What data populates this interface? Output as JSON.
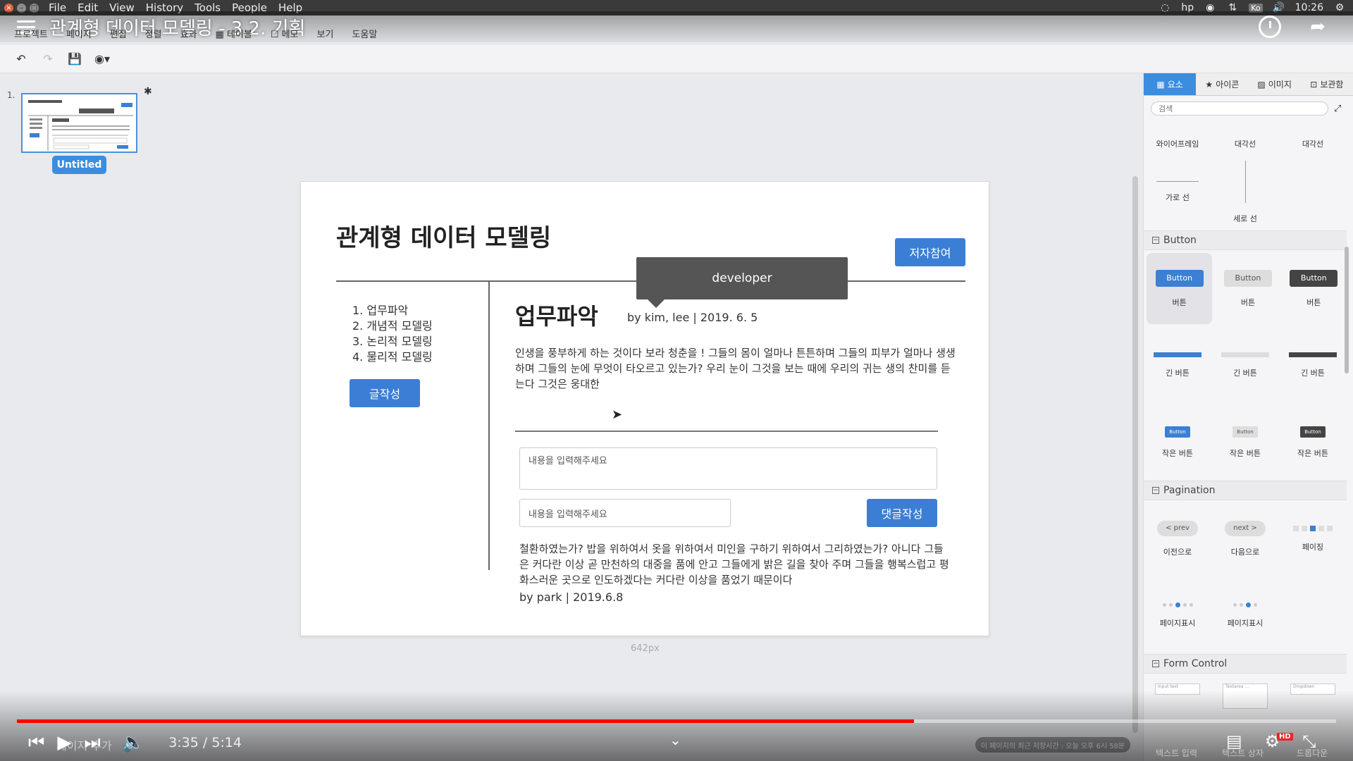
{
  "os": {
    "menu": [
      "File",
      "Edit",
      "View",
      "History",
      "Tools",
      "People",
      "Help"
    ],
    "time": "10:26",
    "lang": "Ko"
  },
  "video": {
    "title": "관계형 데이터 모델링 - 3.2. 기획",
    "current_time": "3:35 / 5:14",
    "progress": 0.68,
    "notice": "이 페이지의 최근 저장시간 : 오늘 오후 6시 58분",
    "faded_left": "페이지 추가",
    "faded_right_1": "텍스트 입력",
    "faded_right_2": "텍스트 상자",
    "faded_right_3": "드롭다운",
    "hd": "HD"
  },
  "app_menu": [
    "프로젝트",
    "페이지",
    "편집",
    "정렬",
    "효과",
    "▦ 테이블",
    "☐ 메모",
    "보기",
    "도움말"
  ],
  "pages": {
    "number": "1.",
    "badge": "Untitled",
    "asterisk": "✱"
  },
  "canvas": {
    "title": "관계형 데이터 모델링",
    "ref_button": "저자참여",
    "tooltip": "developer",
    "nav": [
      "1. 업무파악",
      "2. 개념적 모델링",
      "3. 논리적 모델링",
      "4. 물리적 모델링"
    ],
    "write_button": "글작성",
    "section_title": "업무파악",
    "byline": "by kim, lee   |  2019. 6. 5",
    "body": "인생을 풍부하게 하는 것이다 보라 청춘을 ! 그들의 몸이 얼마나 튼튼하며 그들의 피부가 얼마나 생생하며 그들의 눈에 무엇이 타오르고 있는가? 우리 눈이 그것을 보는 때에 우리의 귀는 생의 찬미를 듣는다 그것은 웅대한",
    "input_placeholder_big": "내용을 입력해주세요",
    "input_placeholder_small": "내용을 입력해주세요",
    "comment_button": "댓글작성",
    "comment": "철환하였는가? 밥을 위하여서 옷을 위하여서 미인을 구하기 위하여서 그리하였는가? 아니다 그들은 커다란 이상 곧 만천하의 대중을 품에 안고 그들에게 밝은 길을 찾아 주며 그들을 행복스럽고 평화스러운 곳으로 인도하겠다는 커다란 이상을 품었기 때문이다",
    "comment_by": "by park | 2019.6.8",
    "size_label": "642px"
  },
  "panel": {
    "tabs": [
      {
        "icon": "▦",
        "label": "요소"
      },
      {
        "icon": "★",
        "label": "아이콘"
      },
      {
        "icon": "▨",
        "label": "이미지"
      },
      {
        "icon": "⊡",
        "label": "보관함"
      }
    ],
    "search_placeholder": "검색",
    "top_items": [
      "와이어프레임",
      "대각선",
      "대각선"
    ],
    "line_items": [
      "가로 선",
      "세로 선"
    ],
    "sections": {
      "button": "Button",
      "pagination": "Pagination",
      "form": "Form Control"
    },
    "button_sample": "Button",
    "button_labels": [
      "버튼",
      "버튼",
      "버튼"
    ],
    "long_button_labels": [
      "긴 버튼",
      "긴 버튼",
      "긴 버튼"
    ],
    "small_button_labels": [
      "작은 버튼",
      "작은 버튼",
      "작은 버튼"
    ],
    "prev": "< prev",
    "next": "next >",
    "pagination_labels": [
      "이전으로",
      "다음으로",
      "페이징"
    ],
    "indicator_labels": [
      "페이지표시",
      "페이지표시"
    ],
    "form_samples": [
      "Input text",
      "Textarea ...",
      "Dropdown"
    ]
  }
}
